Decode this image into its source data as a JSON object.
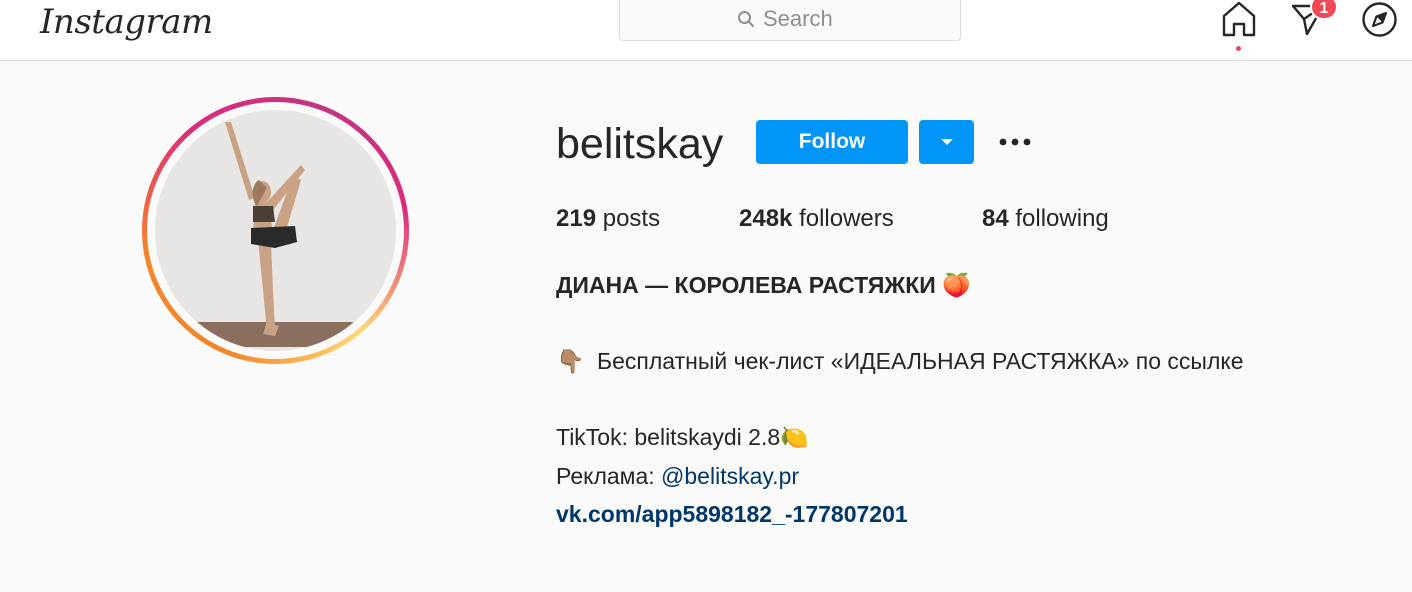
{
  "nav": {
    "logo_text": "Instagram",
    "search_placeholder": "Search",
    "notification_count": "1"
  },
  "profile": {
    "username": "belitskay",
    "follow_label": "Follow",
    "stats": {
      "posts_count": "219",
      "posts_label": "posts",
      "followers_count": "248k",
      "followers_label": "followers",
      "following_count": "84",
      "following_label": "following"
    },
    "bio": {
      "title": "ДИАНА — КОРОЛЕВА РАСТЯЖКИ",
      "title_emoji": "🍑",
      "checklist_emoji": "👇🏽",
      "checklist_text": "Бесплатный чек-лист «ИДЕАЛЬНАЯ РАСТЯЖКА» по ссылке",
      "tiktok_text": "TikTok: belitskaydi 2.8",
      "tiktok_emoji": "🍋",
      "ads_label": "Реклама: ",
      "ads_mention": "@belitskay.pr",
      "website": "vk.com/app5898182_-177807201"
    }
  },
  "colors": {
    "follow_blue": "#0095f6",
    "link_blue": "#00376b",
    "badge_red": "#ed4956",
    "background": "#fafafa"
  },
  "icons": [
    "search-icon",
    "home-icon",
    "direct-message-icon",
    "explore-compass-icon",
    "chevron-down-icon",
    "more-options-icon"
  ]
}
